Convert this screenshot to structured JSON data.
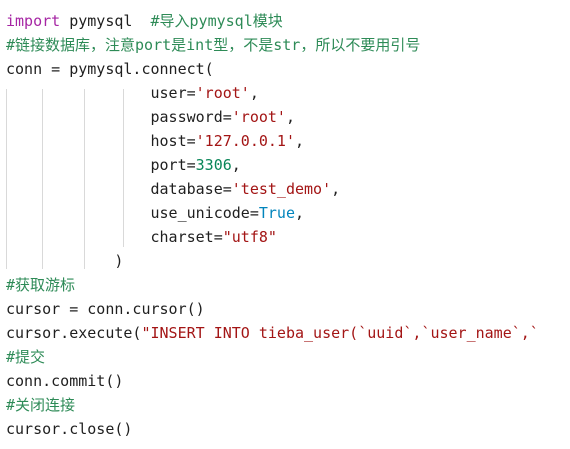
{
  "code": {
    "line1": {
      "kw": "import",
      "rest": " pymysql  ",
      "comment": "#导入pymysql模块"
    },
    "line2": {
      "comment": "#链接数据库，注意port是int型，不是str，所以不要用引号"
    },
    "line3": {
      "text": "conn = pymysql.connect("
    },
    "line4": {
      "indent": "                ",
      "arg": "user=",
      "str": "'root'",
      "tail": ","
    },
    "line5": {
      "indent": "                ",
      "arg": "password=",
      "str": "'root'",
      "tail": ","
    },
    "line6": {
      "indent": "                ",
      "arg": "host=",
      "str": "'127.0.0.1'",
      "tail": ","
    },
    "line7": {
      "indent": "                ",
      "arg": "port=",
      "num": "3306",
      "tail": ","
    },
    "line8": {
      "indent": "                ",
      "arg": "database=",
      "str": "'test_demo'",
      "tail": ","
    },
    "line9": {
      "indent": "                ",
      "arg": "use_unicode=",
      "builtin": "True",
      "tail": ","
    },
    "line10": {
      "indent": "                ",
      "arg": "charset=",
      "str": "\"utf8\""
    },
    "line11": {
      "indent": "            ",
      "text": ")"
    },
    "line12": {
      "comment": "#获取游标"
    },
    "line13": {
      "text": "cursor = conn.cursor()"
    },
    "line14": {
      "pre": "cursor.execute(",
      "str": "\"INSERT INTO tieba_user(`uuid`,`user_name`,`"
    },
    "line15": {
      "comment": "#提交"
    },
    "line16": {
      "text": "conn.commit()"
    },
    "line17": {
      "comment": "#关闭连接"
    },
    "line18": {
      "text": "cursor.close()"
    }
  }
}
